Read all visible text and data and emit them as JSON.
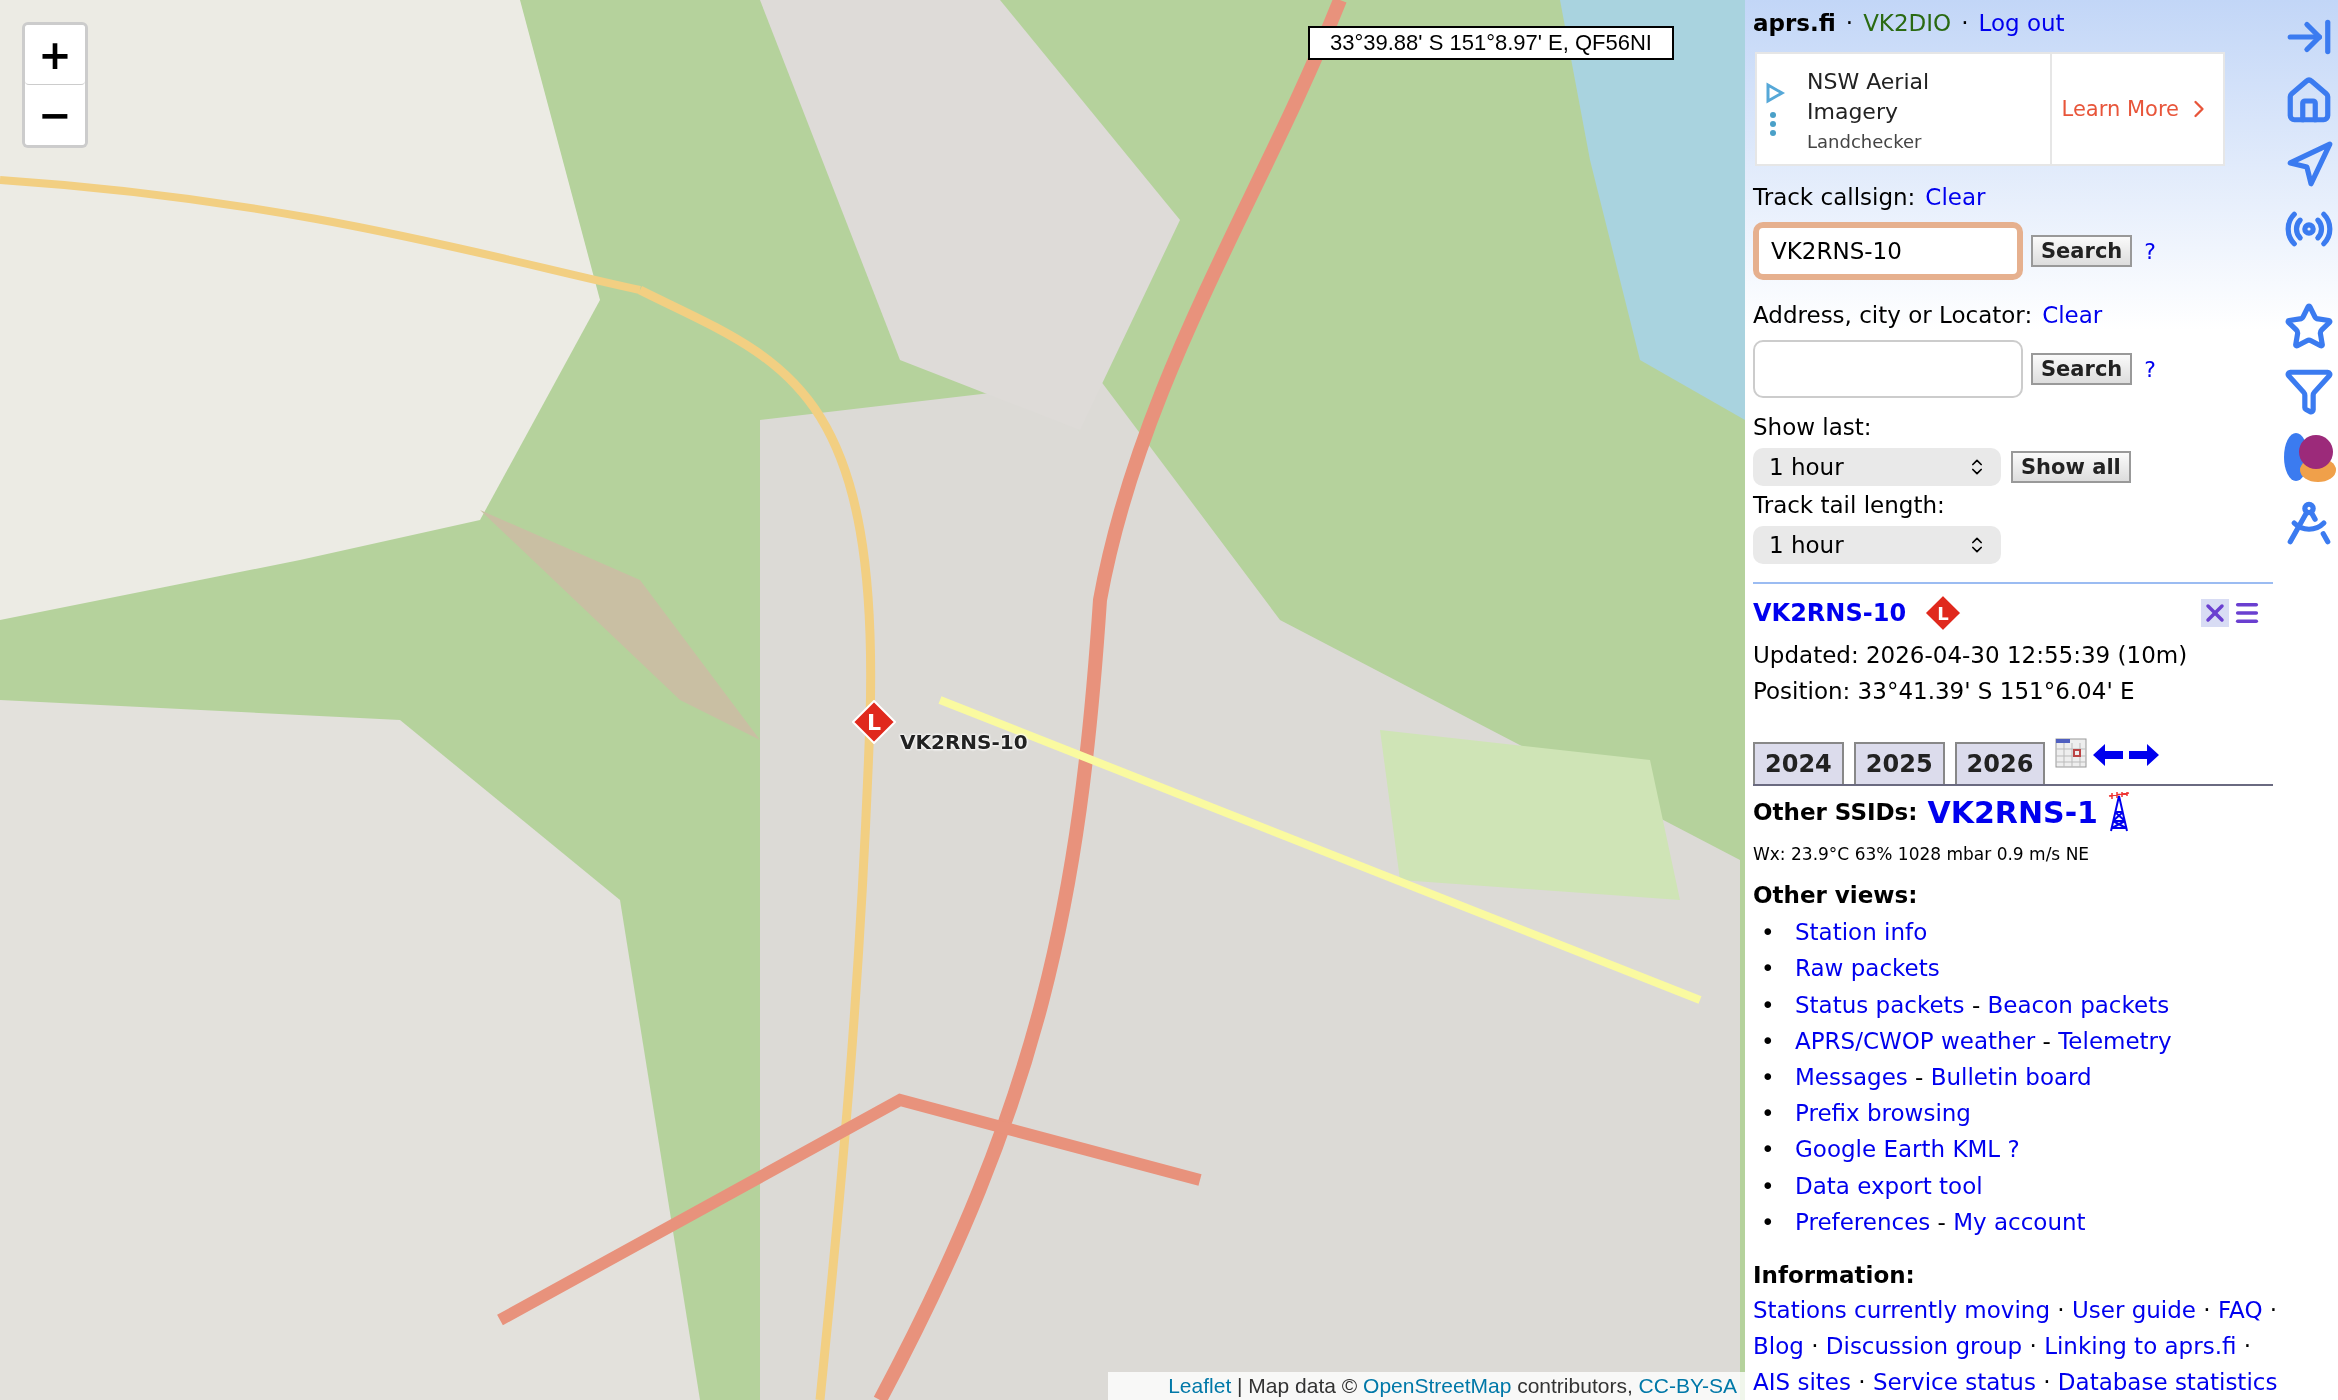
{
  "map": {
    "zoom_in": "+",
    "zoom_out": "−",
    "coordinates": "33°39.88' S 151°8.97' E, QF56NI",
    "marker": {
      "symbol": "L",
      "label": "VK2RNS-10"
    },
    "attribution": [
      {
        "kind": "link",
        "text": "Leaflet"
      },
      {
        "kind": "text",
        "text": " | Map data © "
      },
      {
        "kind": "link",
        "text": "OpenStreetMap"
      },
      {
        "kind": "text",
        "text": " contributors, "
      },
      {
        "kind": "link",
        "text": "CC-BY-SA"
      }
    ]
  },
  "header": {
    "site": "aprs.fi",
    "sep": "·",
    "user": "VK2DIO",
    "logout": "Log out"
  },
  "ad": {
    "title": "NSW Aerial Imagery",
    "advertiser": "Landchecker",
    "cta": "Learn More"
  },
  "search_forms": [
    {
      "label": "Track callsign:",
      "clear": "Clear",
      "value": "VK2RNS-10",
      "focused": true,
      "button": "Search",
      "help": "?"
    },
    {
      "label": "Address, city or Locator:",
      "clear": "Clear",
      "focused": false,
      "button": "Search",
      "help": "?"
    }
  ],
  "show_last": {
    "label": "Show last:",
    "value": "1 hour",
    "button": "Show all"
  },
  "tail": {
    "label": "Track tail length:",
    "value": "1 hour"
  },
  "station": {
    "callsign": "VK2RNS-10",
    "symbol": "L",
    "updated": "Updated: 2026-04-30 12:55:39 (10m)",
    "position": "Position: 33°41.39' S 151°6.04' E"
  },
  "years": [
    "2024",
    "2025",
    "2026"
  ],
  "other_ssids": {
    "label": "Other SSIDs:",
    "callsign": "VK2RNS-1"
  },
  "wx": "Wx: 23.9°C 63% 1028 mbar 0.9 m/s NE",
  "other_views": {
    "title": "Other views:",
    "sep": "-",
    "bullet": "•",
    "items": [
      [
        "Station info"
      ],
      [
        "Raw packets"
      ],
      [
        "Status packets",
        "Beacon packets"
      ],
      [
        "APRS/CWOP weather",
        "Telemetry"
      ],
      [
        "Messages",
        "Bulletin board"
      ],
      [
        "Prefix browsing"
      ],
      [
        "Google Earth KML ?"
      ],
      [
        "Data export tool"
      ],
      [
        "Preferences",
        "My account"
      ]
    ]
  },
  "information": {
    "title": "Information:",
    "sep": "·",
    "lines": [
      {
        "links": [
          "Stations currently moving",
          "User guide",
          "FAQ"
        ],
        "trailing": true
      },
      {
        "links": [
          "Blog",
          "Discussion group",
          "Linking to aprs.fi"
        ],
        "trailing": true
      },
      {
        "links": [
          "AIS sites",
          "Service status",
          "Database statistics"
        ],
        "trailing": false
      }
    ]
  }
}
